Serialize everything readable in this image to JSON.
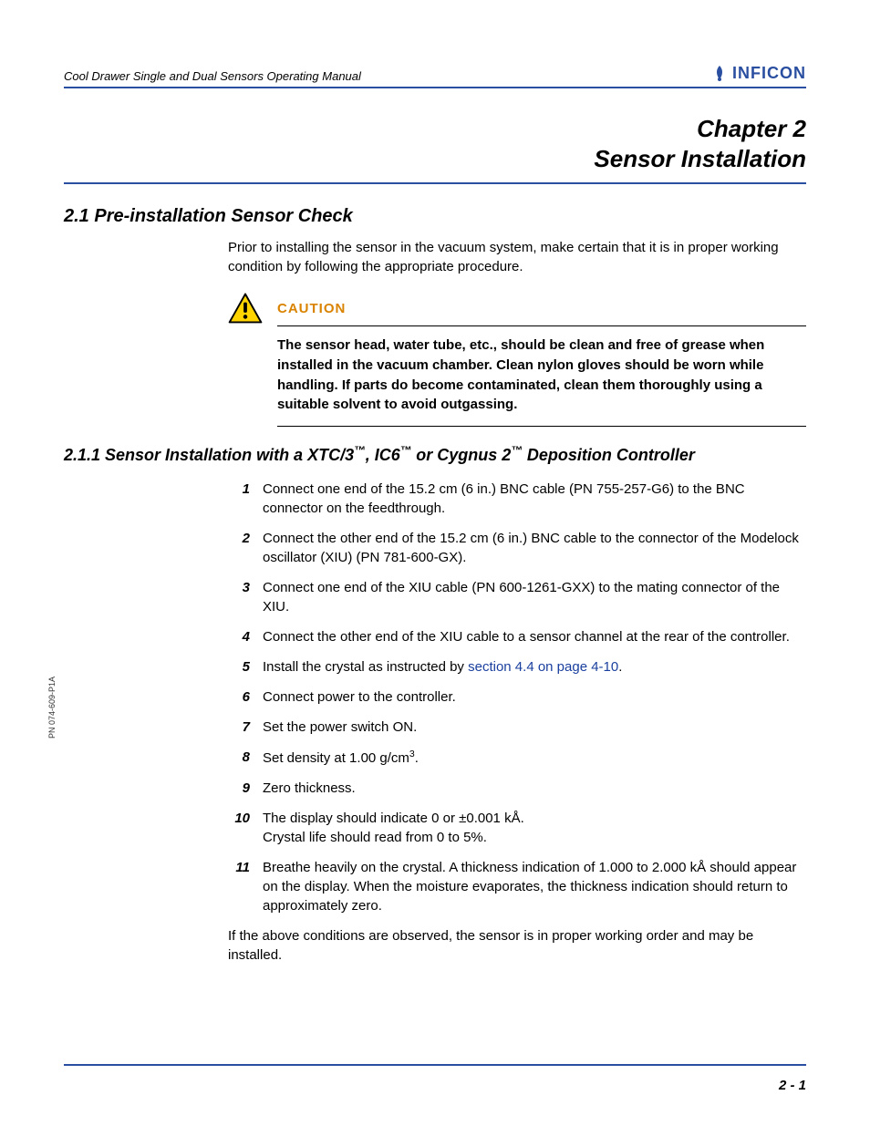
{
  "header": {
    "running_title": "Cool Drawer Single and Dual Sensors Operating Manual",
    "brand": "INFICON"
  },
  "chapter": {
    "line1": "Chapter 2",
    "line2": "Sensor Installation"
  },
  "section_2_1": {
    "heading": "2.1  Pre-installation Sensor Check",
    "intro": "Prior to installing the sensor in the vacuum system, make certain that it is in proper working condition by following the appropriate procedure."
  },
  "caution": {
    "label": "CAUTION",
    "text": "The sensor head, water tube, etc., should be clean and free of grease when installed in the vacuum chamber. Clean nylon gloves should be worn while handling. If parts do become contaminated, clean them thoroughly using a suitable solvent to avoid outgassing."
  },
  "section_2_1_1": {
    "heading_prefix": "2.1.1  Sensor Installation with a XTC/3",
    "heading_mid": ", IC6",
    "heading_tail": " or Cygnus 2",
    "heading_end": " Deposition Controller",
    "tm": "™"
  },
  "steps": [
    "Connect one end of the 15.2 cm (6 in.) BNC cable (PN 755-257-G6) to the BNC connector on the feedthrough.",
    "Connect the other end of the 15.2 cm (6 in.) BNC cable to the connector of the Modelock oscillator (XIU) (PN 781-600-GX).",
    "Connect one end of the XIU cable (PN 600-1261-GXX) to the mating connector of the XIU.",
    "Connect the other end of the XIU cable to a sensor channel at the rear of the controller.",
    "Install the crystal as instructed by ",
    "Connect power to the controller.",
    "Set the power switch ON.",
    "Set density at 1.00 g/cm",
    "Zero thickness.",
    "The display should indicate 0 or ±0.001 kÅ.\nCrystal life should read from 0 to 5%.",
    "Breathe heavily on the crystal. A thickness indication of 1.000 to 2.000 kÅ should appear on the display. When the moisture evaporates, the thickness indication should return to approximately zero."
  ],
  "step5_link": "section 4.4 on page 4-10",
  "step5_tail": ".",
  "step8_sup": "3",
  "step8_tail": ".",
  "closing": "If the above conditions are observed, the sensor is in proper working order and may be installed.",
  "side_pn": "PN 074-609-P1A",
  "page_number": "2 - 1"
}
